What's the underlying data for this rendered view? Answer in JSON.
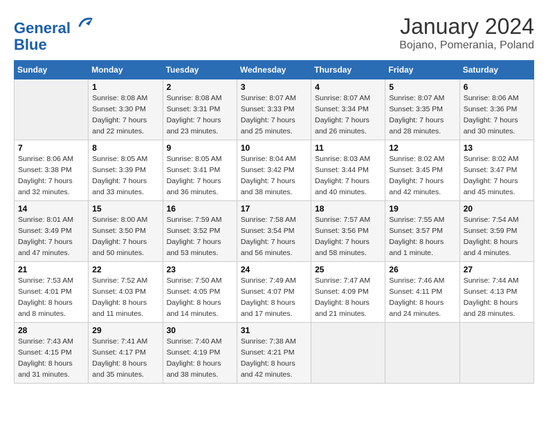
{
  "header": {
    "logo_line1": "General",
    "logo_line2": "Blue",
    "month": "January 2024",
    "location": "Bojano, Pomerania, Poland"
  },
  "days_of_week": [
    "Sunday",
    "Monday",
    "Tuesday",
    "Wednesday",
    "Thursday",
    "Friday",
    "Saturday"
  ],
  "weeks": [
    [
      {
        "day": "",
        "sunrise": "",
        "sunset": "",
        "daylight": ""
      },
      {
        "day": "1",
        "sunrise": "Sunrise: 8:08 AM",
        "sunset": "Sunset: 3:30 PM",
        "daylight": "Daylight: 7 hours and 22 minutes."
      },
      {
        "day": "2",
        "sunrise": "Sunrise: 8:08 AM",
        "sunset": "Sunset: 3:31 PM",
        "daylight": "Daylight: 7 hours and 23 minutes."
      },
      {
        "day": "3",
        "sunrise": "Sunrise: 8:07 AM",
        "sunset": "Sunset: 3:33 PM",
        "daylight": "Daylight: 7 hours and 25 minutes."
      },
      {
        "day": "4",
        "sunrise": "Sunrise: 8:07 AM",
        "sunset": "Sunset: 3:34 PM",
        "daylight": "Daylight: 7 hours and 26 minutes."
      },
      {
        "day": "5",
        "sunrise": "Sunrise: 8:07 AM",
        "sunset": "Sunset: 3:35 PM",
        "daylight": "Daylight: 7 hours and 28 minutes."
      },
      {
        "day": "6",
        "sunrise": "Sunrise: 8:06 AM",
        "sunset": "Sunset: 3:36 PM",
        "daylight": "Daylight: 7 hours and 30 minutes."
      }
    ],
    [
      {
        "day": "7",
        "sunrise": "Sunrise: 8:06 AM",
        "sunset": "Sunset: 3:38 PM",
        "daylight": "Daylight: 7 hours and 32 minutes."
      },
      {
        "day": "8",
        "sunrise": "Sunrise: 8:05 AM",
        "sunset": "Sunset: 3:39 PM",
        "daylight": "Daylight: 7 hours and 33 minutes."
      },
      {
        "day": "9",
        "sunrise": "Sunrise: 8:05 AM",
        "sunset": "Sunset: 3:41 PM",
        "daylight": "Daylight: 7 hours and 36 minutes."
      },
      {
        "day": "10",
        "sunrise": "Sunrise: 8:04 AM",
        "sunset": "Sunset: 3:42 PM",
        "daylight": "Daylight: 7 hours and 38 minutes."
      },
      {
        "day": "11",
        "sunrise": "Sunrise: 8:03 AM",
        "sunset": "Sunset: 3:44 PM",
        "daylight": "Daylight: 7 hours and 40 minutes."
      },
      {
        "day": "12",
        "sunrise": "Sunrise: 8:02 AM",
        "sunset": "Sunset: 3:45 PM",
        "daylight": "Daylight: 7 hours and 42 minutes."
      },
      {
        "day": "13",
        "sunrise": "Sunrise: 8:02 AM",
        "sunset": "Sunset: 3:47 PM",
        "daylight": "Daylight: 7 hours and 45 minutes."
      }
    ],
    [
      {
        "day": "14",
        "sunrise": "Sunrise: 8:01 AM",
        "sunset": "Sunset: 3:49 PM",
        "daylight": "Daylight: 7 hours and 47 minutes."
      },
      {
        "day": "15",
        "sunrise": "Sunrise: 8:00 AM",
        "sunset": "Sunset: 3:50 PM",
        "daylight": "Daylight: 7 hours and 50 minutes."
      },
      {
        "day": "16",
        "sunrise": "Sunrise: 7:59 AM",
        "sunset": "Sunset: 3:52 PM",
        "daylight": "Daylight: 7 hours and 53 minutes."
      },
      {
        "day": "17",
        "sunrise": "Sunrise: 7:58 AM",
        "sunset": "Sunset: 3:54 PM",
        "daylight": "Daylight: 7 hours and 56 minutes."
      },
      {
        "day": "18",
        "sunrise": "Sunrise: 7:57 AM",
        "sunset": "Sunset: 3:56 PM",
        "daylight": "Daylight: 7 hours and 58 minutes."
      },
      {
        "day": "19",
        "sunrise": "Sunrise: 7:55 AM",
        "sunset": "Sunset: 3:57 PM",
        "daylight": "Daylight: 8 hours and 1 minute."
      },
      {
        "day": "20",
        "sunrise": "Sunrise: 7:54 AM",
        "sunset": "Sunset: 3:59 PM",
        "daylight": "Daylight: 8 hours and 4 minutes."
      }
    ],
    [
      {
        "day": "21",
        "sunrise": "Sunrise: 7:53 AM",
        "sunset": "Sunset: 4:01 PM",
        "daylight": "Daylight: 8 hours and 8 minutes."
      },
      {
        "day": "22",
        "sunrise": "Sunrise: 7:52 AM",
        "sunset": "Sunset: 4:03 PM",
        "daylight": "Daylight: 8 hours and 11 minutes."
      },
      {
        "day": "23",
        "sunrise": "Sunrise: 7:50 AM",
        "sunset": "Sunset: 4:05 PM",
        "daylight": "Daylight: 8 hours and 14 minutes."
      },
      {
        "day": "24",
        "sunrise": "Sunrise: 7:49 AM",
        "sunset": "Sunset: 4:07 PM",
        "daylight": "Daylight: 8 hours and 17 minutes."
      },
      {
        "day": "25",
        "sunrise": "Sunrise: 7:47 AM",
        "sunset": "Sunset: 4:09 PM",
        "daylight": "Daylight: 8 hours and 21 minutes."
      },
      {
        "day": "26",
        "sunrise": "Sunrise: 7:46 AM",
        "sunset": "Sunset: 4:11 PM",
        "daylight": "Daylight: 8 hours and 24 minutes."
      },
      {
        "day": "27",
        "sunrise": "Sunrise: 7:44 AM",
        "sunset": "Sunset: 4:13 PM",
        "daylight": "Daylight: 8 hours and 28 minutes."
      }
    ],
    [
      {
        "day": "28",
        "sunrise": "Sunrise: 7:43 AM",
        "sunset": "Sunset: 4:15 PM",
        "daylight": "Daylight: 8 hours and 31 minutes."
      },
      {
        "day": "29",
        "sunrise": "Sunrise: 7:41 AM",
        "sunset": "Sunset: 4:17 PM",
        "daylight": "Daylight: 8 hours and 35 minutes."
      },
      {
        "day": "30",
        "sunrise": "Sunrise: 7:40 AM",
        "sunset": "Sunset: 4:19 PM",
        "daylight": "Daylight: 8 hours and 38 minutes."
      },
      {
        "day": "31",
        "sunrise": "Sunrise: 7:38 AM",
        "sunset": "Sunset: 4:21 PM",
        "daylight": "Daylight: 8 hours and 42 minutes."
      },
      {
        "day": "",
        "sunrise": "",
        "sunset": "",
        "daylight": ""
      },
      {
        "day": "",
        "sunrise": "",
        "sunset": "",
        "daylight": ""
      },
      {
        "day": "",
        "sunrise": "",
        "sunset": "",
        "daylight": ""
      }
    ]
  ]
}
